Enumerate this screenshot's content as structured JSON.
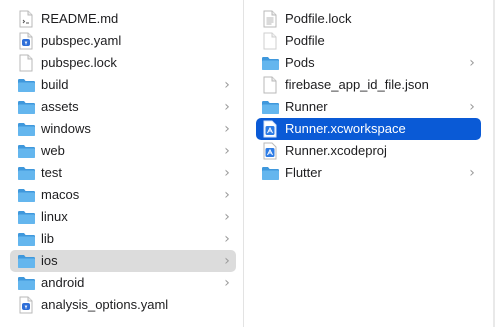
{
  "columns": [
    {
      "items": [
        {
          "label": "README.md",
          "icon": "document-icon",
          "chevron": false
        },
        {
          "label": "pubspec.yaml",
          "icon": "yaml-file-icon",
          "chevron": false
        },
        {
          "label": "pubspec.lock",
          "icon": "document-icon",
          "chevron": false
        },
        {
          "label": "build",
          "icon": "folder-icon",
          "chevron": true
        },
        {
          "label": "assets",
          "icon": "folder-icon",
          "chevron": true
        },
        {
          "label": "windows",
          "icon": "folder-icon",
          "chevron": true
        },
        {
          "label": "web",
          "icon": "folder-icon",
          "chevron": true
        },
        {
          "label": "test",
          "icon": "folder-icon",
          "chevron": true
        },
        {
          "label": "macos",
          "icon": "folder-icon",
          "chevron": true
        },
        {
          "label": "linux",
          "icon": "folder-icon",
          "chevron": true
        },
        {
          "label": "lib",
          "icon": "folder-icon",
          "chevron": true
        },
        {
          "label": "ios",
          "icon": "folder-icon",
          "chevron": true,
          "state": "selected-inactive"
        },
        {
          "label": "android",
          "icon": "folder-icon",
          "chevron": true
        },
        {
          "label": "analysis_options.yaml",
          "icon": "yaml-file-icon",
          "chevron": false
        }
      ]
    },
    {
      "items": [
        {
          "label": "Podfile.lock",
          "icon": "document-lines-icon",
          "chevron": false
        },
        {
          "label": "Podfile",
          "icon": "document-icon",
          "chevron": false
        },
        {
          "label": "Pods",
          "icon": "folder-icon",
          "chevron": true
        },
        {
          "label": "firebase_app_id_file.json",
          "icon": "document-icon",
          "chevron": false
        },
        {
          "label": "Runner",
          "icon": "folder-icon",
          "chevron": true
        },
        {
          "label": "Runner.xcworkspace",
          "icon": "xcode-workspace-icon",
          "chevron": false,
          "state": "selected"
        },
        {
          "label": "Runner.xcodeproj",
          "icon": "xcode-project-icon",
          "chevron": false
        },
        {
          "label": "Flutter",
          "icon": "folder-icon",
          "chevron": true
        }
      ]
    }
  ],
  "chevron_glyph": "›",
  "colors": {
    "selection": "#0a5ad6",
    "inactive_selection": "#dcdcdc",
    "folder": "#5aaee8"
  }
}
